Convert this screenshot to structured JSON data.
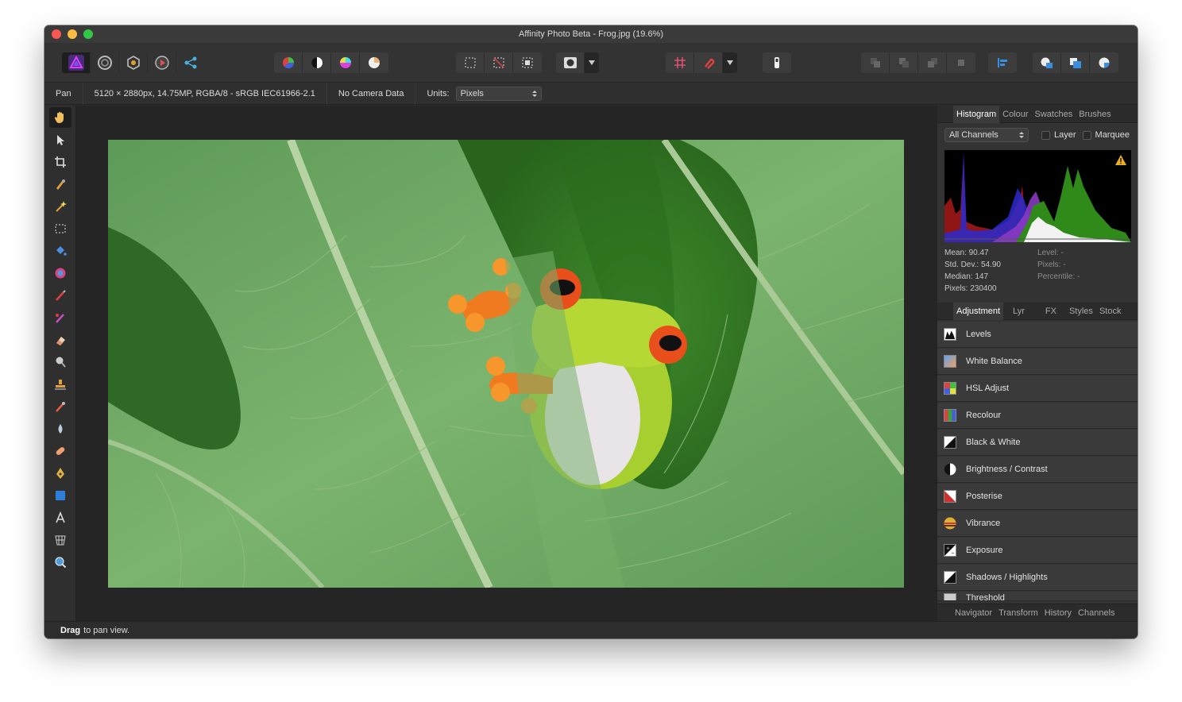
{
  "window": {
    "title": "Affinity Photo Beta - Frog.jpg (19.6%)"
  },
  "toolbar": {
    "persona_icons": [
      "photo-persona-icon",
      "liquify-persona-icon",
      "develop-persona-icon",
      "tone-mapping-persona-icon",
      "export-persona-icon"
    ],
    "adjust_icons": [
      "auto-levels-icon",
      "auto-contrast-icon",
      "auto-colour-icon",
      "auto-white-balance-icon"
    ],
    "selection_icons": [
      "select-all-icon",
      "deselect-icon",
      "invert-pixel-selection-icon"
    ],
    "mask_icon": "quick-mask-icon",
    "snap_icons": [
      "snapping-icon",
      "snapping-magnet-icon"
    ],
    "assistant_icon": "assistant-icon",
    "arrange_icons": [
      "arrange-back-icon",
      "arrange-backward-icon",
      "arrange-forward-icon",
      "arrange-front-icon"
    ],
    "align_icon": "align-icon",
    "boolean_icons": [
      "add-icon",
      "subtract-icon",
      "intersect-icon"
    ]
  },
  "context": {
    "tool_name": "Pan",
    "doc_info": "5120 × 2880px, 14.75MP, RGBA/8 - sRGB IEC61966-2.1",
    "camera": "No Camera Data",
    "units_label": "Units:",
    "units_value": "Pixels"
  },
  "histogram": {
    "tabs": [
      "Histogram",
      "Colour",
      "Swatches",
      "Brushes"
    ],
    "channel_select": "All Channels",
    "layer_label": "Layer",
    "marquee_label": "Marquee",
    "stats_left": [
      "Mean: 90.47",
      "Std. Dev.: 54.90",
      "Median: 147",
      "Pixels: 230400"
    ],
    "stats_right": [
      "Level: -",
      "Pixels: -",
      "Percentile: -"
    ]
  },
  "adjustment": {
    "tabs": [
      "Adjustment",
      "Lyr",
      "FX",
      "Styles",
      "Stock"
    ],
    "items": [
      {
        "label": "Levels",
        "icon": "levels-icon"
      },
      {
        "label": "White Balance",
        "icon": "white-balance-icon"
      },
      {
        "label": "HSL Adjust",
        "icon": "hsl-adjust-icon"
      },
      {
        "label": "Recolour",
        "icon": "recolour-icon"
      },
      {
        "label": "Black & White",
        "icon": "black-white-icon"
      },
      {
        "label": "Brightness / Contrast",
        "icon": "brightness-contrast-icon"
      },
      {
        "label": "Posterise",
        "icon": "posterise-icon"
      },
      {
        "label": "Vibrance",
        "icon": "vibrance-icon"
      },
      {
        "label": "Exposure",
        "icon": "exposure-icon"
      },
      {
        "label": "Shadows / Highlights",
        "icon": "shadows-highlights-icon"
      },
      {
        "label": "Threshold",
        "icon": "threshold-icon"
      }
    ]
  },
  "bottom_tabs": [
    "Navigator",
    "Transform",
    "History",
    "Channels"
  ],
  "status": {
    "bold": "Drag",
    "text": "to pan view."
  },
  "colors": {
    "accent": "#2f7fd8",
    "panel": "#333333",
    "canvas": "#252525"
  }
}
